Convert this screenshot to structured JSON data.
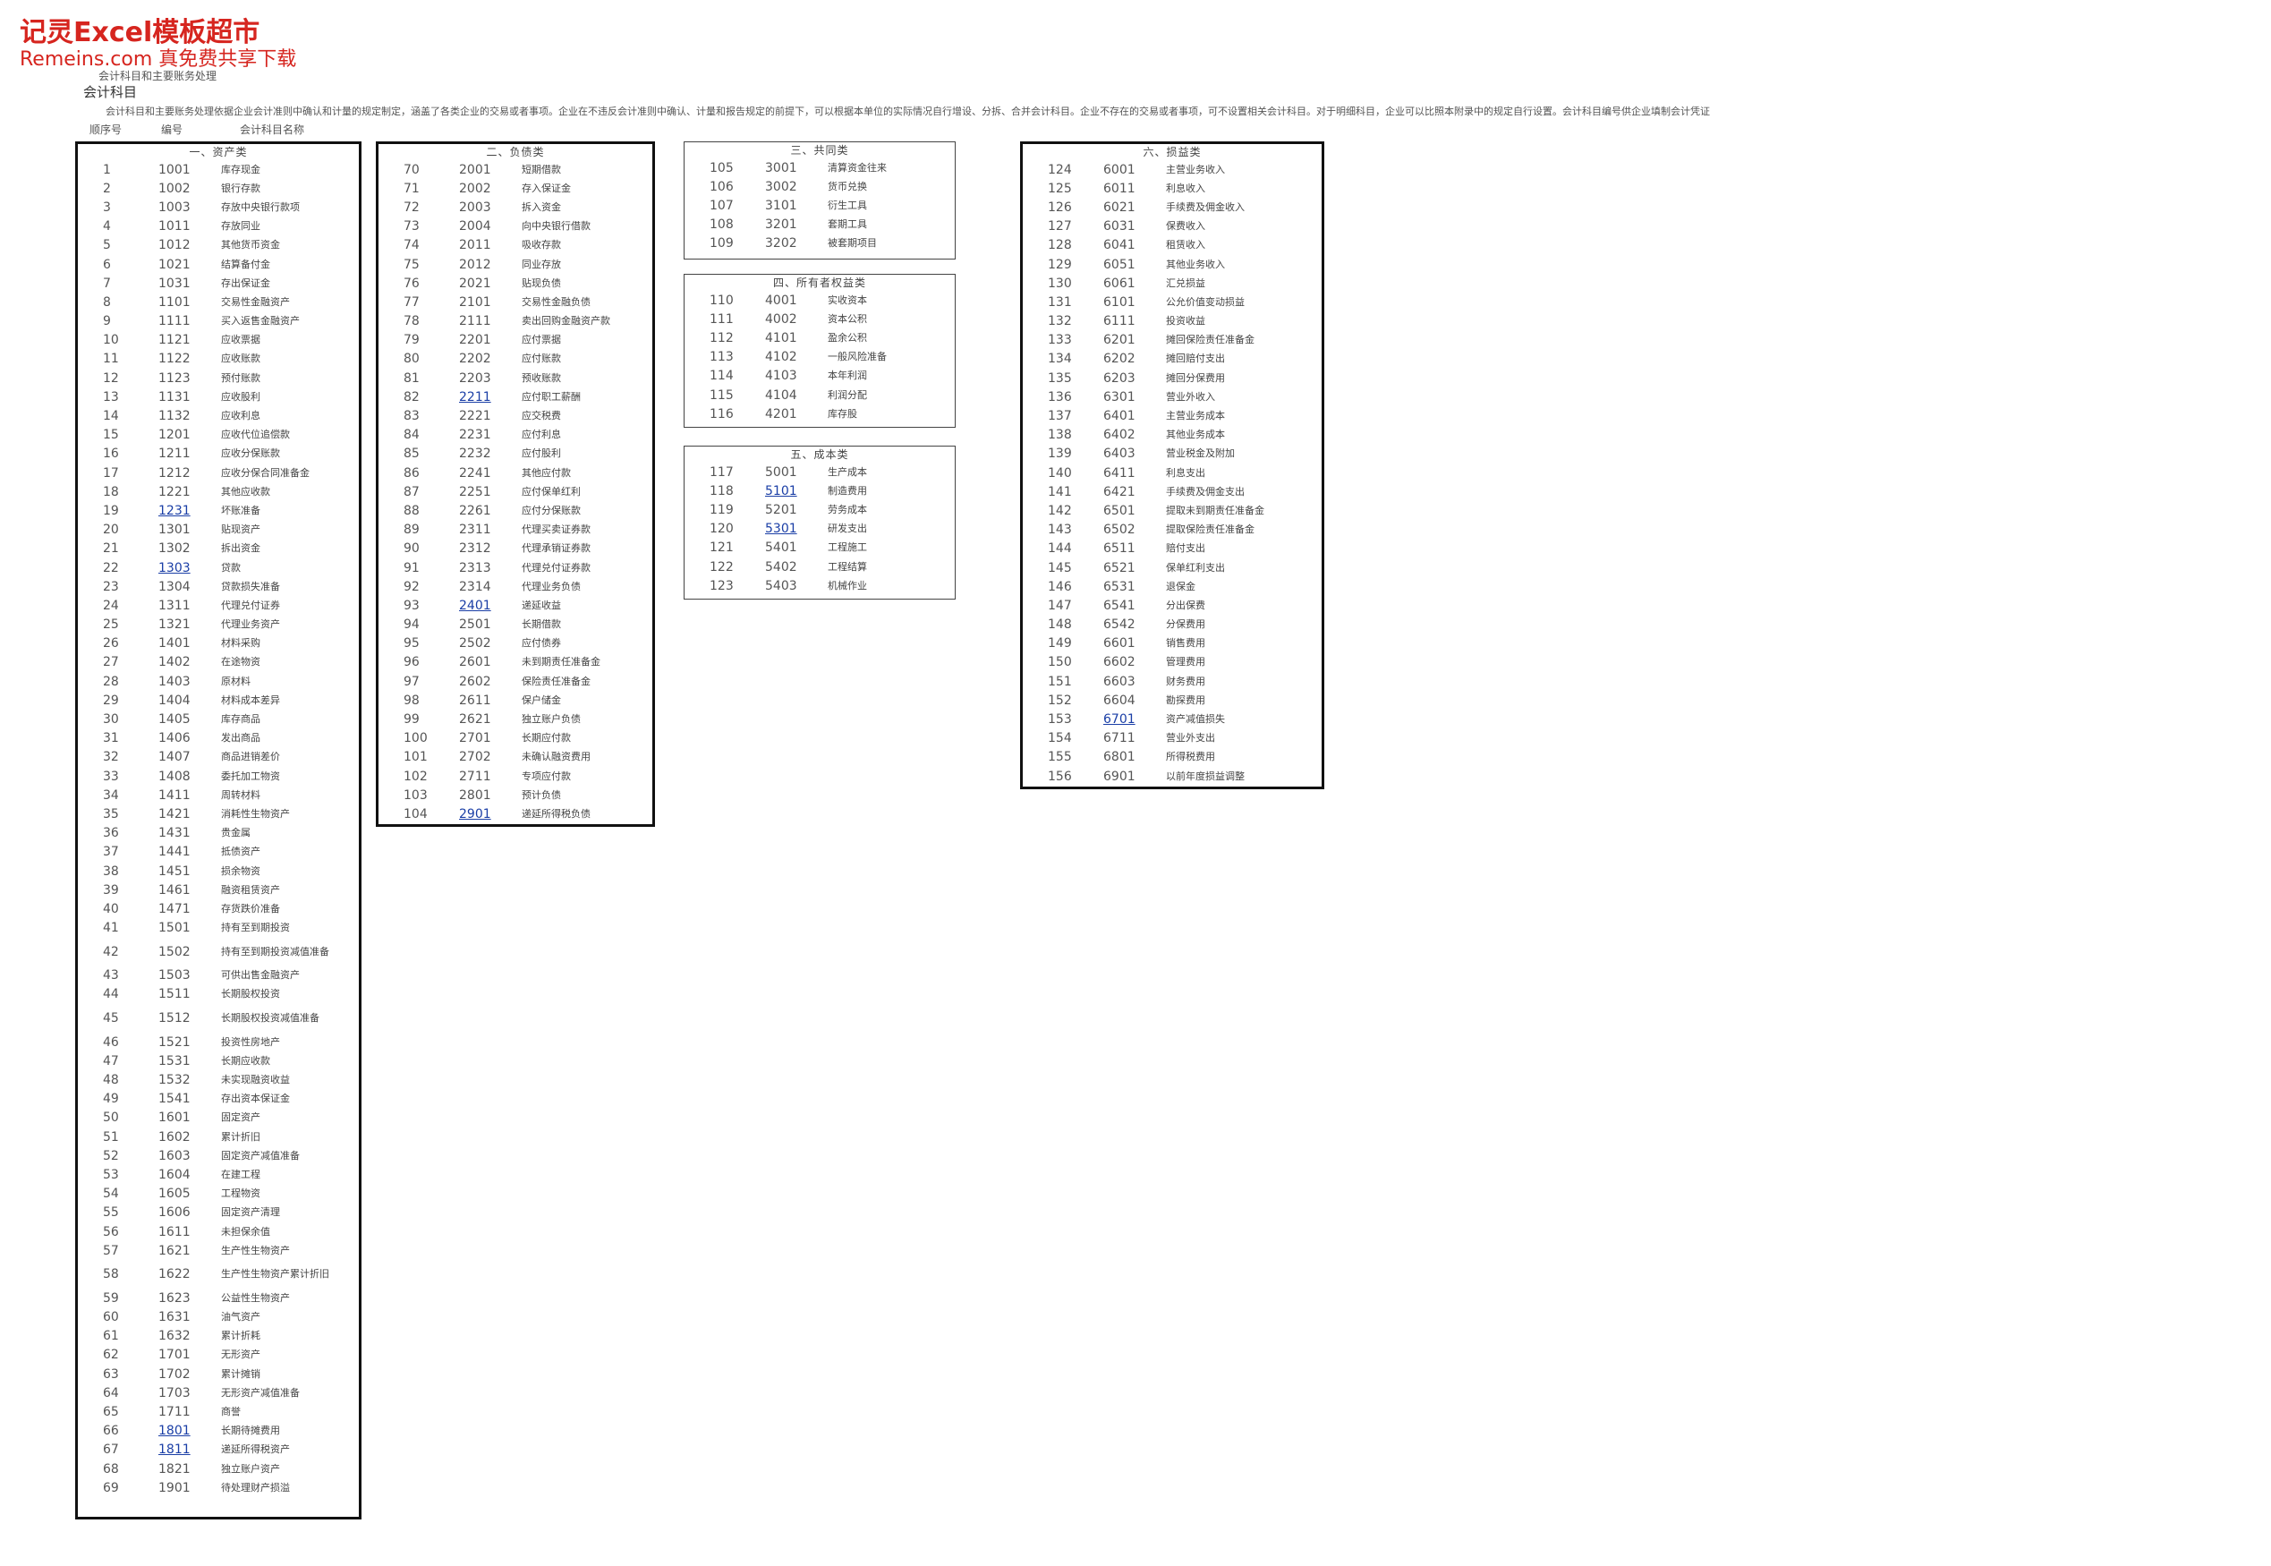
{
  "watermark": {
    "title": "记灵Excel模板超市",
    "subtitle": "Remeins.com 真免费共享下载"
  },
  "doc": {
    "title": "会计科目和主要账务处理",
    "sheet_name": "会计科目",
    "description": "会计科目和主要账务处理依据企业会计准则中确认和计量的规定制定，涵盖了各类企业的交易或者事项。企业在不违反会计准则中确认、计量和报告规定的前提下，可以根据本单位的实际情况自行增设、分拆、合并会计科目。企业不存在的交易或者事项，可不设置相关会计科目。对于明细科目，企业可以比照本附录中的规定自行设置。会计科目编号供企业填制会计凭证"
  },
  "headers": {
    "seq": "顺序号",
    "code": "编号",
    "name": "会计科目名称"
  },
  "sections": [
    {
      "title": "一、资产类",
      "rows": [
        [
          "1",
          "1001",
          "库存现金"
        ],
        [
          "2",
          "1002",
          "银行存款"
        ],
        [
          "3",
          "1003",
          "存放中央银行款项"
        ],
        [
          "4",
          "1011",
          "存放同业"
        ],
        [
          "5",
          "1012",
          "其他货币资金"
        ],
        [
          "6",
          "1021",
          "结算备付金"
        ],
        [
          "7",
          "1031",
          "存出保证金"
        ],
        [
          "8",
          "1101",
          "交易性金融资产"
        ],
        [
          "9",
          "1111",
          "买入返售金融资产"
        ],
        [
          "10",
          "1121",
          "应收票据"
        ],
        [
          "11",
          "1122",
          "应收账款"
        ],
        [
          "12",
          "1123",
          "预付账款"
        ],
        [
          "13",
          "1131",
          "应收股利"
        ],
        [
          "14",
          "1132",
          "应收利息"
        ],
        [
          "15",
          "1201",
          "应收代位追偿款"
        ],
        [
          "16",
          "1211",
          "应收分保账款"
        ],
        [
          "17",
          "1212",
          "应收分保合同准备金"
        ],
        [
          "18",
          "1221",
          "其他应收款"
        ],
        [
          "19",
          "1231",
          "坏账准备"
        ],
        [
          "20",
          "1301",
          "贴现资产"
        ],
        [
          "21",
          "1302",
          "拆出资金"
        ],
        [
          "22",
          "1303",
          "贷款"
        ],
        [
          "23",
          "1304",
          "贷款损失准备"
        ],
        [
          "24",
          "1311",
          "代理兑付证券"
        ],
        [
          "25",
          "1321",
          "代理业务资产"
        ],
        [
          "26",
          "1401",
          "材料采购"
        ],
        [
          "27",
          "1402",
          "在途物资"
        ],
        [
          "28",
          "1403",
          "原材料"
        ],
        [
          "29",
          "1404",
          "材料成本差异"
        ],
        [
          "30",
          "1405",
          "库存商品"
        ],
        [
          "31",
          "1406",
          "发出商品"
        ],
        [
          "32",
          "1407",
          "商品进销差价"
        ],
        [
          "33",
          "1408",
          "委托加工物资"
        ],
        [
          "34",
          "1411",
          "周转材料"
        ],
        [
          "35",
          "1421",
          "消耗性生物资产"
        ],
        [
          "36",
          "1431",
          "贵金属"
        ],
        [
          "37",
          "1441",
          "抵债资产"
        ],
        [
          "38",
          "1451",
          "损余物资"
        ],
        [
          "39",
          "1461",
          "融资租赁资产"
        ],
        [
          "40",
          "1471",
          "存货跌价准备"
        ],
        [
          "41",
          "1501",
          "持有至到期投资"
        ],
        [
          "42",
          "1502",
          "持有至到期投资减值准备"
        ],
        [
          "43",
          "1503",
          "可供出售金融资产"
        ],
        [
          "44",
          "1511",
          "长期股权投资"
        ],
        [
          "45",
          "1512",
          "长期股权投资减值准备"
        ],
        [
          "46",
          "1521",
          "投资性房地产"
        ],
        [
          "47",
          "1531",
          "长期应收款"
        ],
        [
          "48",
          "1532",
          "未实现融资收益"
        ],
        [
          "49",
          "1541",
          "存出资本保证金"
        ],
        [
          "50",
          "1601",
          "固定资产"
        ],
        [
          "51",
          "1602",
          "累计折旧"
        ],
        [
          "52",
          "1603",
          "固定资产减值准备"
        ],
        [
          "53",
          "1604",
          "在建工程"
        ],
        [
          "54",
          "1605",
          "工程物资"
        ],
        [
          "55",
          "1606",
          "固定资产清理"
        ],
        [
          "56",
          "1611",
          "未担保余值"
        ],
        [
          "57",
          "1621",
          "生产性生物资产"
        ],
        [
          "58",
          "1622",
          "生产性生物资产累计折旧"
        ],
        [
          "59",
          "1623",
          "公益性生物资产"
        ],
        [
          "60",
          "1631",
          "油气资产"
        ],
        [
          "61",
          "1632",
          "累计折耗"
        ],
        [
          "62",
          "1701",
          "无形资产"
        ],
        [
          "63",
          "1702",
          "累计摊销"
        ],
        [
          "64",
          "1703",
          "无形资产减值准备"
        ],
        [
          "65",
          "1711",
          "商誉"
        ],
        [
          "66",
          "1801",
          "长期待摊费用"
        ],
        [
          "67",
          "1811",
          "递延所得税资产"
        ],
        [
          "68",
          "1821",
          "独立账户资产"
        ],
        [
          "69",
          "1901",
          "待处理财产损溢"
        ]
      ]
    },
    {
      "title": "二、负债类",
      "rows": [
        [
          "70",
          "2001",
          "短期借款"
        ],
        [
          "71",
          "2002",
          "存入保证金"
        ],
        [
          "72",
          "2003",
          "拆入资金"
        ],
        [
          "73",
          "2004",
          "向中央银行借款"
        ],
        [
          "74",
          "2011",
          "吸收存款"
        ],
        [
          "75",
          "2012",
          "同业存放"
        ],
        [
          "76",
          "2021",
          "贴现负债"
        ],
        [
          "77",
          "2101",
          "交易性金融负债"
        ],
        [
          "78",
          "2111",
          "卖出回购金融资产款"
        ],
        [
          "79",
          "2201",
          "应付票据"
        ],
        [
          "80",
          "2202",
          "应付账款"
        ],
        [
          "81",
          "2203",
          "预收账款"
        ],
        [
          "82",
          "2211",
          "应付职工薪酬"
        ],
        [
          "83",
          "2221",
          "应交税费"
        ],
        [
          "84",
          "2231",
          "应付利息"
        ],
        [
          "85",
          "2232",
          "应付股利"
        ],
        [
          "86",
          "2241",
          "其他应付款"
        ],
        [
          "87",
          "2251",
          "应付保单红利"
        ],
        [
          "88",
          "2261",
          "应付分保账款"
        ],
        [
          "89",
          "2311",
          "代理买卖证券款"
        ],
        [
          "90",
          "2312",
          "代理承销证券款"
        ],
        [
          "91",
          "2313",
          "代理兑付证券款"
        ],
        [
          "92",
          "2314",
          "代理业务负债"
        ],
        [
          "93",
          "2401",
          "递延收益"
        ],
        [
          "94",
          "2501",
          "长期借款"
        ],
        [
          "95",
          "2502",
          "应付债券"
        ],
        [
          "96",
          "2601",
          "未到期责任准备金"
        ],
        [
          "97",
          "2602",
          "保险责任准备金"
        ],
        [
          "98",
          "2611",
          "保户储金"
        ],
        [
          "99",
          "2621",
          "独立账户负债"
        ],
        [
          "100",
          "2701",
          "长期应付款"
        ],
        [
          "101",
          "2702",
          "未确认融资费用"
        ],
        [
          "102",
          "2711",
          "专项应付款"
        ],
        [
          "103",
          "2801",
          "预计负债"
        ],
        [
          "104",
          "2901",
          "递延所得税负债"
        ]
      ]
    },
    {
      "title": "三、共同类",
      "rows": [
        [
          "105",
          "3001",
          "清算资金往来"
        ],
        [
          "106",
          "3002",
          "货币兑换"
        ],
        [
          "107",
          "3101",
          "衍生工具"
        ],
        [
          "108",
          "3201",
          "套期工具"
        ],
        [
          "109",
          "3202",
          "被套期项目"
        ]
      ]
    },
    {
      "title": "四、所有者权益类",
      "rows": [
        [
          "110",
          "4001",
          "实收资本"
        ],
        [
          "111",
          "4002",
          "资本公积"
        ],
        [
          "112",
          "4101",
          "盈余公积"
        ],
        [
          "113",
          "4102",
          "一般风险准备"
        ],
        [
          "114",
          "4103",
          "本年利润"
        ],
        [
          "115",
          "4104",
          "利润分配"
        ],
        [
          "116",
          "4201",
          "库存股"
        ]
      ]
    },
    {
      "title": "五、成本类",
      "rows": [
        [
          "117",
          "5001",
          "生产成本"
        ],
        [
          "118",
          "5101",
          "制造费用"
        ],
        [
          "119",
          "5201",
          "劳务成本"
        ],
        [
          "120",
          "5301",
          "研发支出"
        ],
        [
          "121",
          "5401",
          "工程施工"
        ],
        [
          "122",
          "5402",
          "工程结算"
        ],
        [
          "123",
          "5403",
          "机械作业"
        ]
      ]
    },
    {
      "title": "六、损益类",
      "rows": [
        [
          "124",
          "6001",
          "主营业务收入"
        ],
        [
          "125",
          "6011",
          "利息收入"
        ],
        [
          "126",
          "6021",
          "手续费及佣金收入"
        ],
        [
          "127",
          "6031",
          "保费收入"
        ],
        [
          "128",
          "6041",
          "租赁收入"
        ],
        [
          "129",
          "6051",
          "其他业务收入"
        ],
        [
          "130",
          "6061",
          "汇兑损益"
        ],
        [
          "131",
          "6101",
          "公允价值变动损益"
        ],
        [
          "132",
          "6111",
          "投资收益"
        ],
        [
          "133",
          "6201",
          "摊回保险责任准备金"
        ],
        [
          "134",
          "6202",
          "摊回赔付支出"
        ],
        [
          "135",
          "6203",
          "摊回分保费用"
        ],
        [
          "136",
          "6301",
          "营业外收入"
        ],
        [
          "137",
          "6401",
          "主营业务成本"
        ],
        [
          "138",
          "6402",
          "其他业务成本"
        ],
        [
          "139",
          "6403",
          "营业税金及附加"
        ],
        [
          "140",
          "6411",
          "利息支出"
        ],
        [
          "141",
          "6421",
          "手续费及佣金支出"
        ],
        [
          "142",
          "6501",
          "提取未到期责任准备金"
        ],
        [
          "143",
          "6502",
          "提取保险责任准备金"
        ],
        [
          "144",
          "6511",
          "赔付支出"
        ],
        [
          "145",
          "6521",
          "保单红利支出"
        ],
        [
          "146",
          "6531",
          "退保金"
        ],
        [
          "147",
          "6541",
          "分出保费"
        ],
        [
          "148",
          "6542",
          "分保费用"
        ],
        [
          "149",
          "6601",
          "销售费用"
        ],
        [
          "150",
          "6602",
          "管理费用"
        ],
        [
          "151",
          "6603",
          "财务费用"
        ],
        [
          "152",
          "6604",
          "勘探费用"
        ],
        [
          "153",
          "6701",
          "资产减值损失"
        ],
        [
          "154",
          "6711",
          "营业外支出"
        ],
        [
          "155",
          "6801",
          "所得税费用"
        ],
        [
          "156",
          "6901",
          "以前年度损益调整"
        ]
      ]
    }
  ]
}
